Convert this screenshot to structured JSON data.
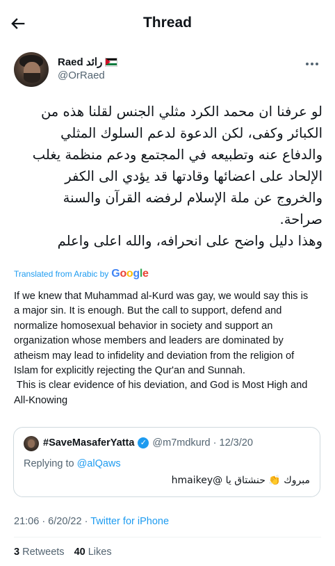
{
  "header": {
    "title": "Thread",
    "back_icon": "arrow-left-icon"
  },
  "author": {
    "name": "Raed رائد",
    "flag_icon": "palestine-flag-icon",
    "handle": "@OrRaed",
    "more_icon": "more-horizontal-icon"
  },
  "tweet": {
    "arabic_lines": [
      "لو عرفنا ان محمد الكرد مثلي الجنس لقلنا هذه من",
      "الكبائر وكفى، لكن الدعوة لدعم السلوك المثلي",
      "والدفاع عنه وتطبيعه في المجتمع ودعم منظمة يغلب",
      "الإلحاد على اعضائها وقادتها قد يؤدي الى الكفر",
      "والخروج عن ملة الإسلام لرفضه القرآن والسنة",
      "صراحة.",
      "وهذا دليل واضح على انحرافه، والله اعلى واعلم"
    ],
    "translated_label": "Translated from Arabic by",
    "google_letters": [
      "G",
      "o",
      "o",
      "g",
      "l",
      "e"
    ],
    "english_lines": [
      "If we knew that Muhammad al-Kurd was gay, we would say this is",
      "a major sin. It is enough. But the call to support, defend and",
      "normalize homosexual behavior in society and support an",
      "organization whose members and leaders are dominated by",
      "atheism may lead to infidelity and deviation from the religion of",
      "Islam for explicitly rejecting the Qur'an and Sunnah.",
      " This is clear evidence of his deviation, and God is Most High and",
      "All-Knowing"
    ]
  },
  "quote": {
    "name": "#SaveMasaferYatta",
    "verified_icon": "verified-badge-icon",
    "handle_date": "@m7mdkurd · 12/3/20",
    "replying_prefix": "Replying to",
    "replying_handle": "@alQaws",
    "text": "مبروك 👏 حنشتاق يا @hmaikey"
  },
  "meta": {
    "time_date": "21:06 · 6/20/22 · ",
    "source": "Twitter for iPhone"
  },
  "stats": {
    "retweets_count": "3",
    "retweets_label": "Retweets",
    "likes_count": "40",
    "likes_label": "Likes"
  },
  "colors": {
    "link": "#1d9bf0",
    "secondary_text": "#536471",
    "border": "#cfd9de"
  }
}
